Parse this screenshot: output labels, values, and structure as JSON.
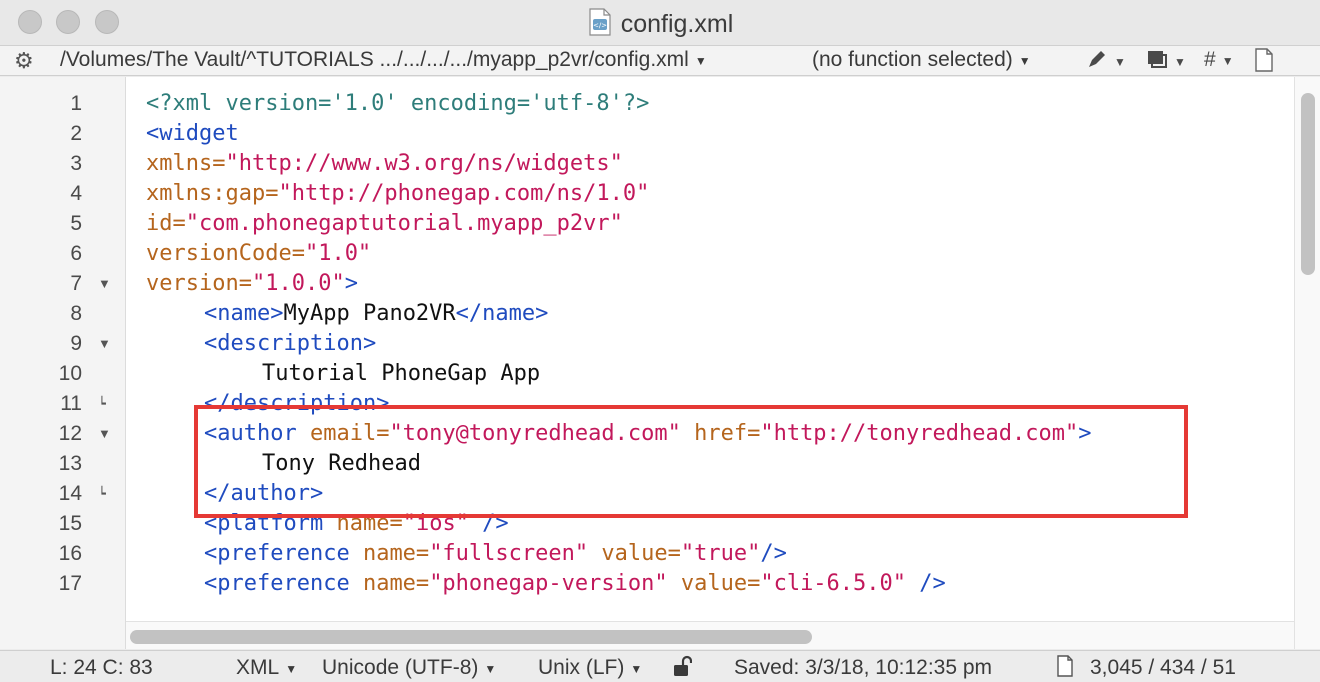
{
  "window": {
    "title": "config.xml"
  },
  "navbar": {
    "path": "/Volumes/The Vault/^TUTORIALS .../.../.../.../myapp_p2vr/config.xml",
    "function": "(no function selected)",
    "hash_label": "#"
  },
  "editor": {
    "lines": [
      {
        "num": "1"
      },
      {
        "num": "2"
      },
      {
        "num": "3"
      },
      {
        "num": "4"
      },
      {
        "num": "5"
      },
      {
        "num": "6"
      },
      {
        "num": "7"
      },
      {
        "num": "8"
      },
      {
        "num": "9"
      },
      {
        "num": "10"
      },
      {
        "num": "11"
      },
      {
        "num": "12"
      },
      {
        "num": "13"
      },
      {
        "num": "14"
      },
      {
        "num": "15"
      },
      {
        "num": "16"
      },
      {
        "num": "17"
      }
    ],
    "code": {
      "l1": "<?xml version='1.0' encoding='utf-8'?>",
      "l2_tag": "<widget",
      "l3_attr": "xmlns=",
      "l3_val": "\"http://www.w3.org/ns/widgets\"",
      "l4_attr": "xmlns:gap=",
      "l4_val": "\"http://phonegap.com/ns/1.0\"",
      "l5_attr": "id=",
      "l5_val": "\"com.phonegaptutorial.myapp_p2vr\"",
      "l6_attr": "versionCode=",
      "l6_val": "\"1.0\"",
      "l7_attr": "version=",
      "l7_val": "\"1.0.0\"",
      "l7_end": ">",
      "l8_open": "<name>",
      "l8_text": "MyApp Pano2VR",
      "l8_close": "</name>",
      "l9_tag": "<description>",
      "l10_text": "Tutorial PhoneGap App",
      "l11_tag": "</description>",
      "l12_open": "<author",
      "l12_attr1": " email=",
      "l12_val1": "\"tony@tonyredhead.com\"",
      "l12_attr2": " href=",
      "l12_val2": "\"http://tonyredhead.com\"",
      "l12_end": ">",
      "l13_text": "Tony Redhead",
      "l14_tag": "</author>",
      "l15_open": "<platform",
      "l15_attr": " name=",
      "l15_val": "\"ios\"",
      "l15_end": " />",
      "l16_open": "<preference",
      "l16_attr1": " name=",
      "l16_val1": "\"fullscreen\"",
      "l16_attr2": " value=",
      "l16_val2": "\"true\"",
      "l16_end": "/>",
      "l17_open": "<preference",
      "l17_attr1": " name=",
      "l17_val1": "\"phonegap-version\"",
      "l17_attr2": " value=",
      "l17_val2": "\"cli-6.5.0\"",
      "l17_end": " />"
    }
  },
  "statusbar": {
    "position": "L: 24 C: 83",
    "language": "XML",
    "encoding": "Unicode (UTF-8)",
    "line_endings": "Unix (LF)",
    "saved": "Saved: 3/3/18, 10:12:35 pm",
    "counts": "3,045 / 434 / 51"
  },
  "colors": {
    "tag": "#1f4bbf",
    "attribute": "#b5651d",
    "value": "#c2185b",
    "processing_instruction": "#2e7d7a",
    "highlight": "#e53935"
  }
}
